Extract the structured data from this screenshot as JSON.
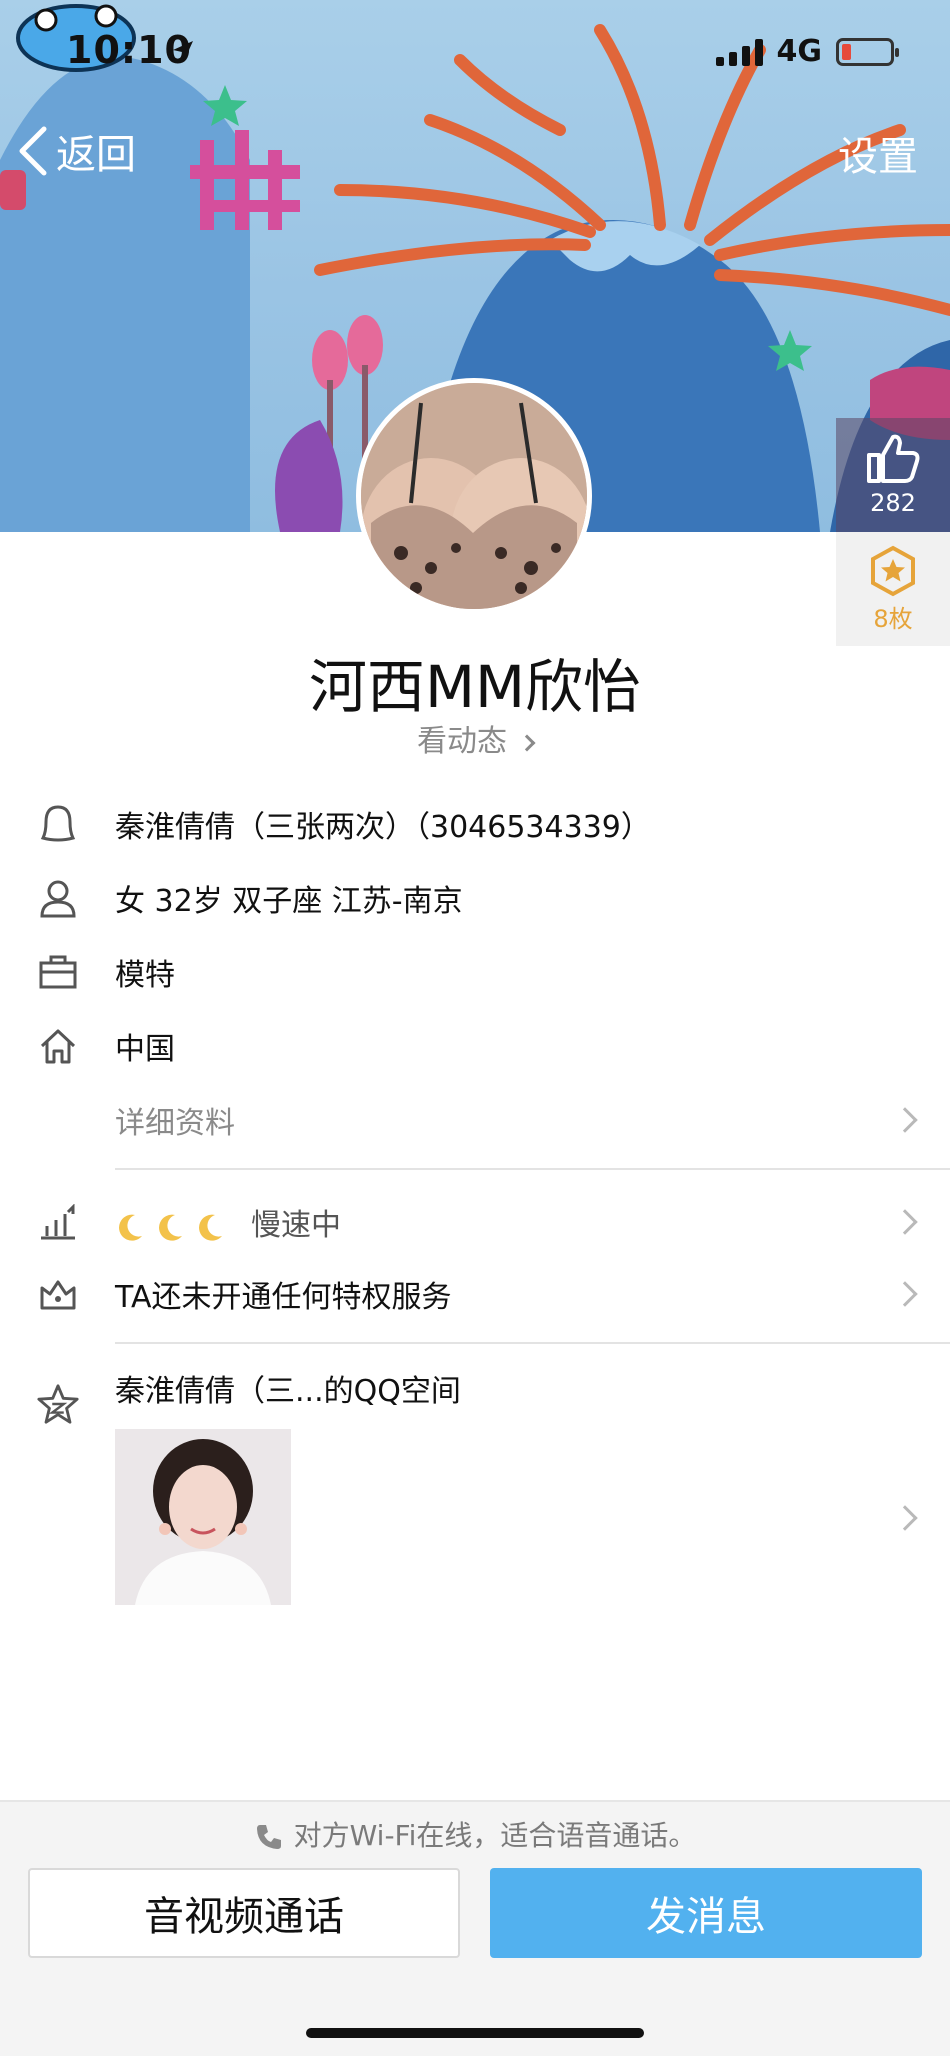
{
  "status_bar": {
    "time": "10:10",
    "network": "4G",
    "battery_level": 0.1
  },
  "nav": {
    "back_label": "返回",
    "settings_label": "设置"
  },
  "side": {
    "like_count": "282",
    "badge_count": "8枚"
  },
  "profile": {
    "name": "河西MM欣怡",
    "moments_link": "看动态"
  },
  "info": {
    "nickname_qq": "秦淮倩倩（三张两次）（3046534339）",
    "basic": "女 32岁 双子座 江苏-南京",
    "job": "模特",
    "hometown": "中国",
    "details_link": "详细资料"
  },
  "level": {
    "speed_label": "慢速中",
    "moon_count": 3
  },
  "vip": {
    "label": "TA还未开通任何特权服务"
  },
  "qzone": {
    "title": "秦淮倩倩（三...的QQ空间"
  },
  "bottom": {
    "hint": "对方Wi-Fi在线，适合语音通话。",
    "call_button": "音视频通话",
    "message_button": "发消息"
  },
  "colors": {
    "primary_button": "#52b1ef",
    "badge": "#e6a43a",
    "banner_bg": "#9ac4e4"
  }
}
